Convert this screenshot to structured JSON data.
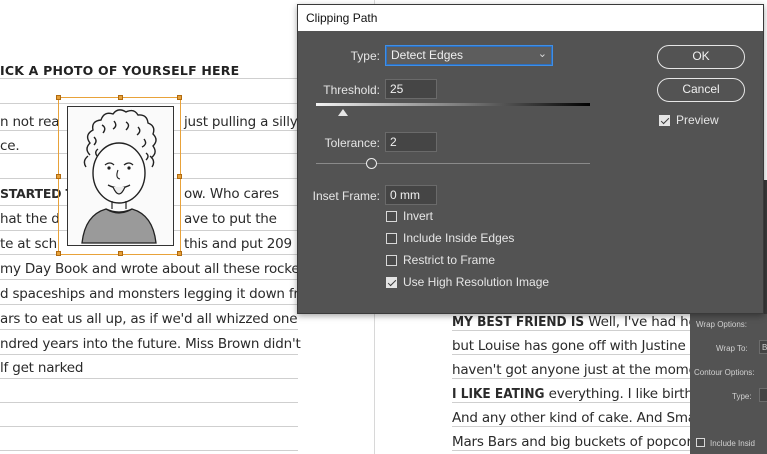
{
  "dialog": {
    "title": "Clipping Path",
    "type_label": "Type:",
    "type_value": "Detect Edges",
    "threshold_label": "Threshold:",
    "threshold_value": "25",
    "tolerance_label": "Tolerance:",
    "tolerance_value": "2",
    "inset_label": "Inset Frame:",
    "inset_value": "0 mm",
    "checkboxes": [
      {
        "label": "Invert",
        "checked": false
      },
      {
        "label": "Include Inside Edges",
        "checked": false
      },
      {
        "label": "Restrict to Frame",
        "checked": false
      },
      {
        "label": "Use High Resolution Image",
        "checked": true
      }
    ],
    "ok_label": "OK",
    "cancel_label": "Cancel",
    "preview_label": "Preview",
    "preview_checked": true
  },
  "document": {
    "left_heading": "ICK A PHOTO OF YOURSELF HERE",
    "left_lines": [
      "n not rea",
      "just pulling a silly",
      "ce.",
      "STARTED T",
      "ow. Who cares",
      "hat the d",
      "ave to put the",
      "te at sch",
      "this and put 209",
      "my Day Book and wrote about all these rockets",
      "d spaceships and monsters legging it down from",
      "ars to eat us all up, as if we'd all whizzed one",
      "ndred years into the future. Miss Brown didn't",
      "lf get narked"
    ],
    "right_lines": [
      {
        "bold": "MY BEST FRIEND IS",
        "text": " Well, I've had heaps o"
      },
      {
        "bold": "",
        "text": "but Louise has gone off with Justine a"
      },
      {
        "bold": "",
        "text": "haven't got anyone just at the momen"
      },
      {
        "bold": "I LIKE EATING",
        "text": " everything. I like birthday c"
      },
      {
        "bold": "",
        "text": "And any other kind of cake. And Smar"
      },
      {
        "bold": "",
        "text": "Mars Bars and big buckets of popcorn"
      }
    ]
  },
  "wrap_panel": {
    "wrap_options": "Wrap Options:",
    "wrap_to": "Wrap To:",
    "wrap_to_value": "B",
    "contour_options": "Contour Options:",
    "type": "Type:",
    "include_inside": "Include Insid"
  }
}
